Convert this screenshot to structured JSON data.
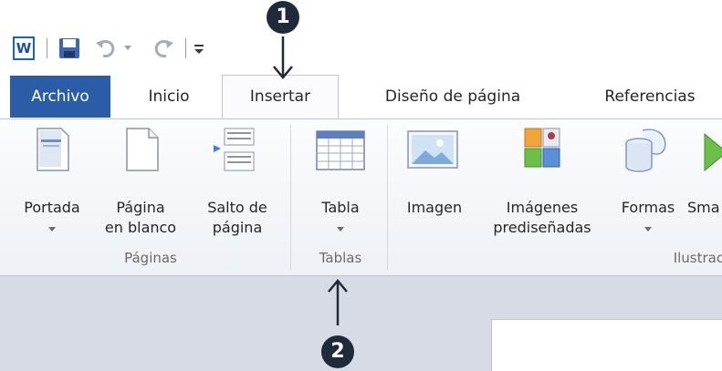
{
  "qat": {
    "app_icon_letter": "W",
    "icons": [
      "word-app-icon",
      "save-icon",
      "undo-icon",
      "redo-icon",
      "customize-qat-icon"
    ]
  },
  "tabs": [
    {
      "label": "Archivo"
    },
    {
      "label": "Inicio"
    },
    {
      "label": "Insertar"
    },
    {
      "label": "Diseño de página"
    },
    {
      "label": "Referencias"
    }
  ],
  "active_tab": "Insertar",
  "groups": {
    "paginas": {
      "label": "Páginas",
      "buttons": {
        "portada": "Portada",
        "pagina_en_blanco": "Página\nen blanco",
        "salto_de_pagina": "Salto de\npágina"
      }
    },
    "tablas": {
      "label": "Tablas",
      "buttons": {
        "tabla": "Tabla"
      }
    },
    "ilustraciones": {
      "label": "Ilustraciones",
      "buttons": {
        "imagen": "Imagen",
        "imagenes_prediseñadas": "Imágenes\nprediseñadas",
        "formas": "Formas",
        "smartart": "Sma"
      }
    }
  },
  "annotations": {
    "badge1": "1",
    "badge2": "2"
  },
  "colors": {
    "archivo_tab": "#2b5ca8",
    "badge": "#1f2a3a",
    "doc_background": "#d6dbe5"
  }
}
